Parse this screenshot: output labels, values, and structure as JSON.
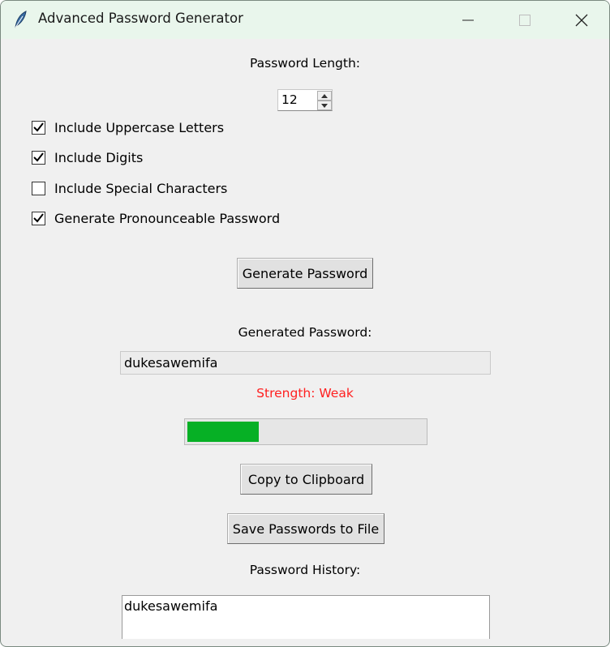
{
  "window": {
    "title": "Advanced Password Generator",
    "icon": "feather-icon"
  },
  "length": {
    "label": "Password Length:",
    "value": "12"
  },
  "options": [
    {
      "label": "Include Uppercase Letters",
      "checked": true
    },
    {
      "label": "Include Digits",
      "checked": true
    },
    {
      "label": "Include Special Characters",
      "checked": false
    },
    {
      "label": "Generate Pronounceable Password",
      "checked": true
    }
  ],
  "buttons": {
    "generate": "Generate Password",
    "copy": "Copy to Clipboard",
    "save": "Save Passwords to File"
  },
  "generated": {
    "label": "Generated Password:",
    "value": "dukesawemifa"
  },
  "strength": {
    "text": "Strength: Weak",
    "color": "#ff2020",
    "progress_fraction": 0.3,
    "bar_color": "#06b025"
  },
  "history": {
    "label": "Password History:",
    "items": [
      "dukesawemifa"
    ]
  }
}
